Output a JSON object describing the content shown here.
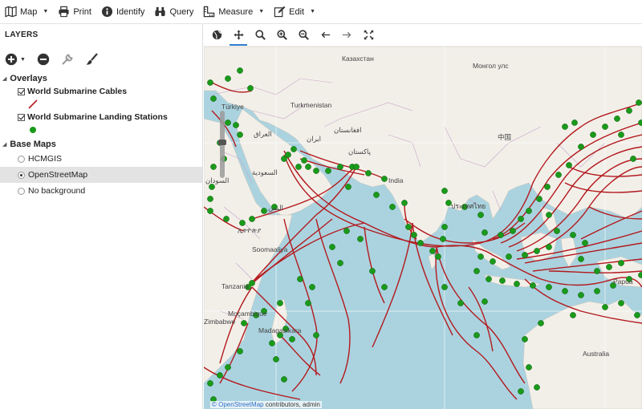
{
  "toolbar": {
    "items": [
      {
        "label": "Map",
        "icon": "map-icon",
        "dropdown": true
      },
      {
        "label": "Print",
        "icon": "print-icon",
        "dropdown": false
      },
      {
        "label": "Identify",
        "icon": "info-icon",
        "dropdown": false
      },
      {
        "label": "Query",
        "icon": "binoculars-icon",
        "dropdown": false
      },
      {
        "label": "Measure",
        "icon": "ruler-icon",
        "dropdown": true
      },
      {
        "label": "Edit",
        "icon": "edit-icon",
        "dropdown": true
      }
    ]
  },
  "layers_panel": {
    "title": "LAYERS",
    "tools": [
      "add-icon",
      "remove-icon",
      "wrench-icon",
      "brush-icon"
    ],
    "overlays": {
      "heading": "Overlays",
      "layers": [
        {
          "label": "World Submarine Cables",
          "checked": true,
          "symbol": "line",
          "color": "#b3191d"
        },
        {
          "label": "World Submarine Landing Stations",
          "checked": true,
          "symbol": "point",
          "color": "#1a9a1a"
        }
      ]
    },
    "base_maps": {
      "heading": "Base Maps",
      "options": [
        {
          "label": "HCMGIS",
          "selected": false
        },
        {
          "label": "OpenStreetMap",
          "selected": true
        },
        {
          "label": "No background",
          "selected": false
        }
      ]
    }
  },
  "map_tools": [
    "globe-icon",
    "pan-icon",
    "zoom-box-icon",
    "zoom-in-icon",
    "zoom-out-icon",
    "back-arrow-icon",
    "forward-arrow-icon",
    "full-extent-icon"
  ],
  "map": {
    "labels": [
      "Казахстан",
      "Монгол улс",
      "Türkiye",
      "Turkmenistan",
      "ایران",
      "افغانستان",
      "پاکستان",
      "中国",
      "العراق",
      "السعودية",
      "السودان",
      "اليمن",
      "ኢትዮጵያ",
      "Soomaaliya",
      "India",
      "Tanzania",
      "Moçambique",
      "Madagasikara",
      "Zimbabwe",
      "ประเทศไทย",
      "Australia",
      "Papua"
    ],
    "attribution_link": "© OpenStreetMap",
    "attribution_rest": " contributors, admin",
    "colors": {
      "land": "#f2efe9",
      "sea": "#aad3df",
      "cable": "#b3191d",
      "station": "#1a9a1a"
    }
  }
}
